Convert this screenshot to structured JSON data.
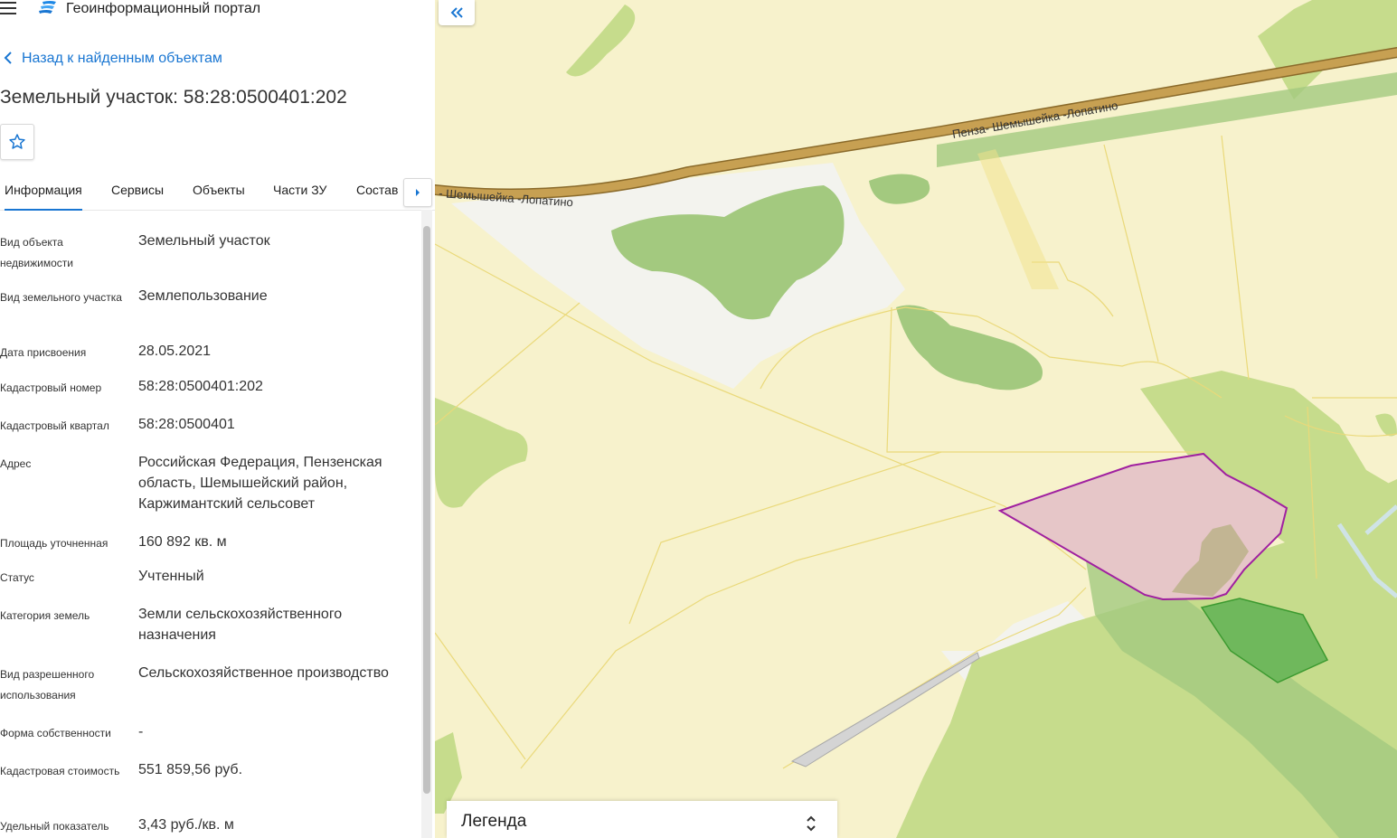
{
  "header": {
    "app_title": "Геоинформационный портал"
  },
  "nav": {
    "back_label": "Назад к найденным объектам"
  },
  "page": {
    "title": "Земельный участок: 58:28:0500401:202"
  },
  "tabs": [
    {
      "label": "Информация",
      "active": true
    },
    {
      "label": "Сервисы"
    },
    {
      "label": "Объекты"
    },
    {
      "label": "Части ЗУ"
    },
    {
      "label": "Состав"
    }
  ],
  "info": [
    {
      "label": "Вид объекта недвижимости",
      "value": "Земельный участок"
    },
    {
      "label": "Вид земельного участка",
      "value": "Землепользование"
    },
    {
      "label": "Дата присвоения",
      "value": "28.05.2021"
    },
    {
      "label": "Кадастровый номер",
      "value": "58:28:0500401:202"
    },
    {
      "label": "Кадастровый квартал",
      "value": "58:28:0500401"
    },
    {
      "label": "Адрес",
      "value": "Российская Федерация, Пензенская область, Шемышейский район, Каржимантский сельсовет"
    },
    {
      "label": "Площадь уточненная",
      "value": "160 892 кв. м"
    },
    {
      "label": "Статус",
      "value": "Учтенный"
    },
    {
      "label": "Категория земель",
      "value": "Земли сельскохозяйственного назначения"
    },
    {
      "label": "Вид разрешенного использования",
      "value": "Сельскохозяйственное производство"
    },
    {
      "label": "Форма собственности",
      "value": "-"
    },
    {
      "label": "Кадастровая стоимость",
      "value": "551 859,56 руб."
    },
    {
      "label": "Удельный показатель",
      "value": "3,43 руб./кв. м"
    }
  ],
  "map": {
    "road_label_1": "Пенза- Шемышейка -Лопатино",
    "road_label_2": "- Шемышейка -Лопатино",
    "colors": {
      "background": "#f7f2cc",
      "forest": "#c6dc8c",
      "dark_forest": "#a3c97f",
      "road": "#c7a052",
      "parcel_fill": "#e6c6c8",
      "parcel_stroke": "#a020a0",
      "selected_green": "#6fb85c"
    }
  },
  "legend": {
    "title": "Легенда"
  }
}
